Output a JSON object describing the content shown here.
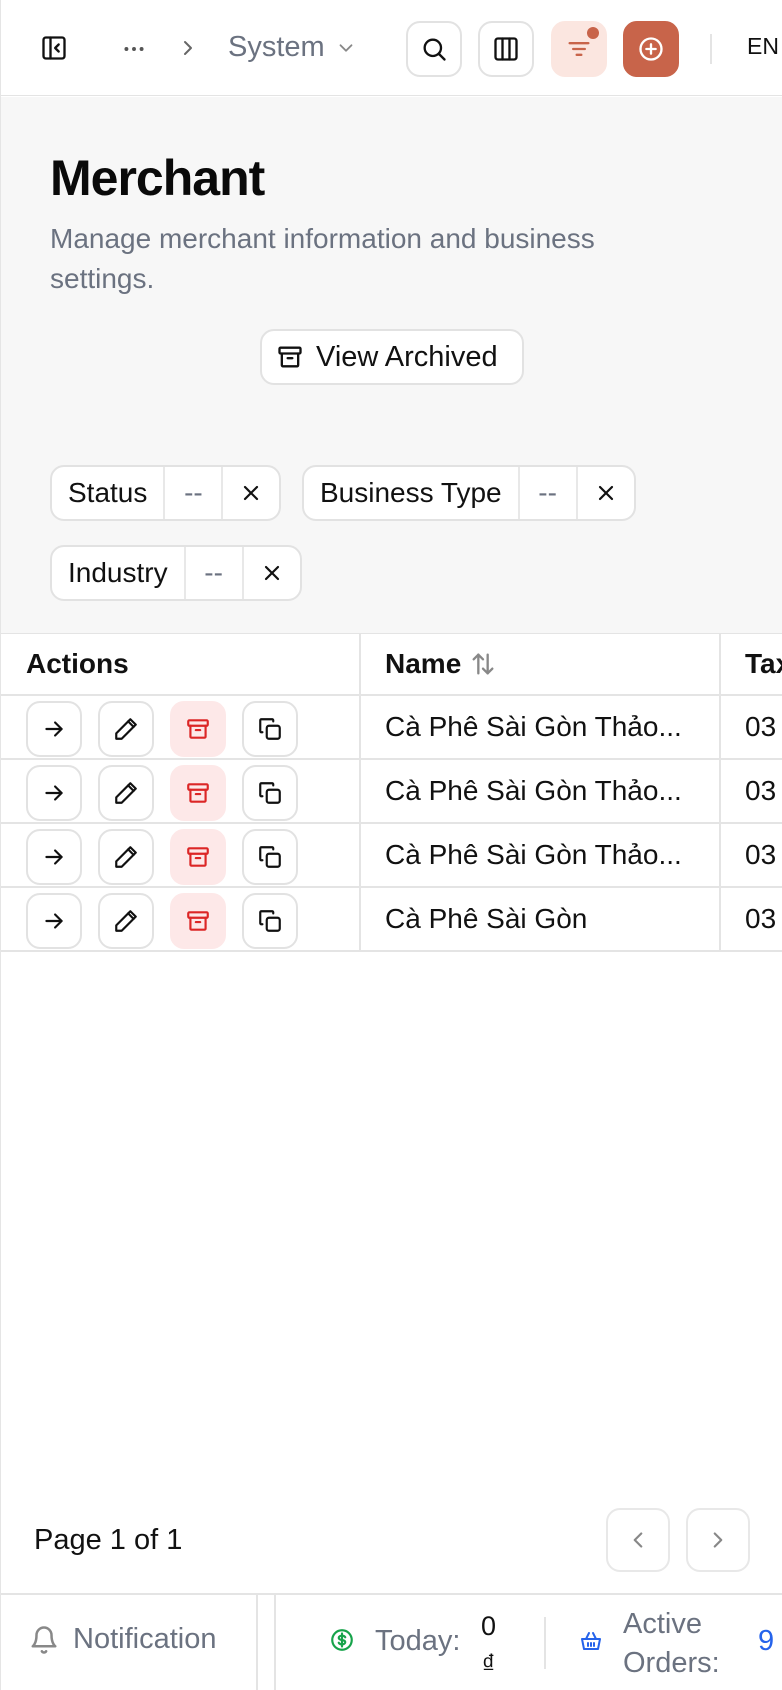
{
  "topbar": {
    "breadcrumb_current": "System",
    "language": "EN"
  },
  "header": {
    "title": "Merchant",
    "subtitle": "Manage merchant information and business settings.",
    "view_archived_label": "View Archived"
  },
  "filters": [
    {
      "label": "Status",
      "value": "--"
    },
    {
      "label": "Business Type",
      "value": "--"
    },
    {
      "label": "Industry",
      "value": "--"
    }
  ],
  "table": {
    "columns": [
      "Actions",
      "Name",
      "Tax"
    ],
    "rows": [
      {
        "name": "Cà Phê Sài Gòn Thảo...",
        "tax": "03"
      },
      {
        "name": "Cà Phê Sài Gòn Thảo...",
        "tax": "03"
      },
      {
        "name": "Cà Phê Sài Gòn Thảo...",
        "tax": "03"
      },
      {
        "name": "Cà Phê Sài Gòn",
        "tax": "03"
      }
    ]
  },
  "pagination": {
    "text": "Page 1 of 1"
  },
  "bottombar": {
    "notification_label": "Notification",
    "today_label": "Today:",
    "today_value_number": "0",
    "today_value_currency": "₫",
    "active_orders_label_1": "Active",
    "active_orders_label_2": "Orders:",
    "active_orders_value": "9"
  },
  "colors": {
    "accent": "#c8644a",
    "danger": "#dc2626",
    "danger_bg": "#fde8e8",
    "money_green": "#16a34a",
    "link_blue": "#2563eb",
    "muted": "#6b7280"
  }
}
